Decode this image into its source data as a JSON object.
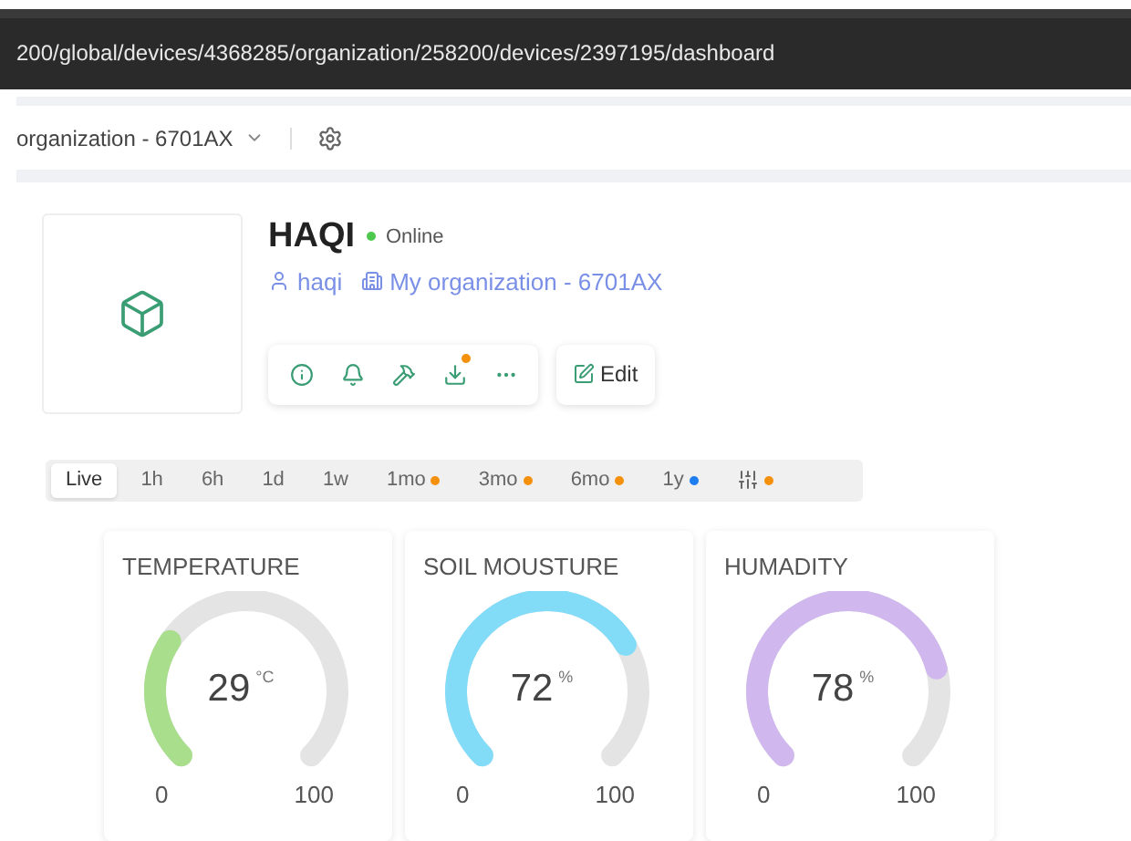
{
  "address_bar": {
    "url": "200/global/devices/4368285/organization/258200/devices/2397195/dashboard"
  },
  "breadcrumb": {
    "label": "organization - 6701AX"
  },
  "device": {
    "name": "HAQI",
    "status": "Online",
    "online": true,
    "owner": "haqi",
    "organization": "My organization - 6701AX"
  },
  "actions": [
    {
      "kind": "info",
      "badge": false
    },
    {
      "kind": "bell",
      "badge": false
    },
    {
      "kind": "tools",
      "badge": false
    },
    {
      "kind": "download",
      "badge": true
    },
    {
      "kind": "more",
      "badge": false
    }
  ],
  "edit_button": "Edit",
  "time_ranges": [
    {
      "label": "Live",
      "selected": true
    },
    {
      "label": "1h",
      "selected": false
    },
    {
      "label": "6h",
      "selected": false
    },
    {
      "label": "1d",
      "selected": false
    },
    {
      "label": "1w",
      "selected": false
    },
    {
      "label": "1mo",
      "selected": false,
      "color": "#f5900a"
    },
    {
      "label": "3mo",
      "selected": false,
      "color": "#f5900a"
    },
    {
      "label": "6mo",
      "selected": false,
      "color": "#f5900a"
    },
    {
      "label": "1y",
      "selected": false,
      "color": "#1e7ef0"
    },
    {
      "kind": "filters",
      "selected": false,
      "color": "#f5900a"
    }
  ],
  "gauges": [
    {
      "title": "TEMPERATURE",
      "value": "29",
      "unit": "°C",
      "min": "0",
      "max": "100",
      "color": "#a8de8c"
    },
    {
      "title": "SOIL MOUSTURE",
      "value": "72",
      "unit": "%",
      "min": "0",
      "max": "100",
      "color": "#82dcf8"
    },
    {
      "title": "HUMADITY",
      "value": "78",
      "unit": "%",
      "min": "0",
      "max": "100",
      "color": "#d0b8ee"
    }
  ]
}
